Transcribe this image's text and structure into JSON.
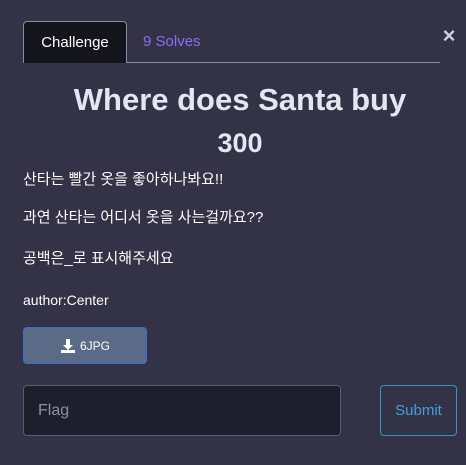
{
  "tabs": {
    "challenge_label": "Challenge",
    "solves_label": "9 Solves"
  },
  "close_glyph": "×",
  "challenge": {
    "title": "Where does Santa buy",
    "points": "300",
    "description": [
      "산타는 빨간 옷을 좋아하나봐요!!",
      "과연 산타는 어디서 옷을 사는걸까요??",
      "공백은_로 표시해주세요",
      "author:Center"
    ]
  },
  "file": {
    "label": "6JPG",
    "icon": "download-icon"
  },
  "flag_input": {
    "placeholder": "Flag",
    "value": ""
  },
  "submit_label": "Submit",
  "colors": {
    "background": "#333247",
    "active_tab": "#14141d",
    "solves_link": "#8a6ef2",
    "submit_accent": "#3fa0db",
    "file_button": "#5b6a86"
  }
}
